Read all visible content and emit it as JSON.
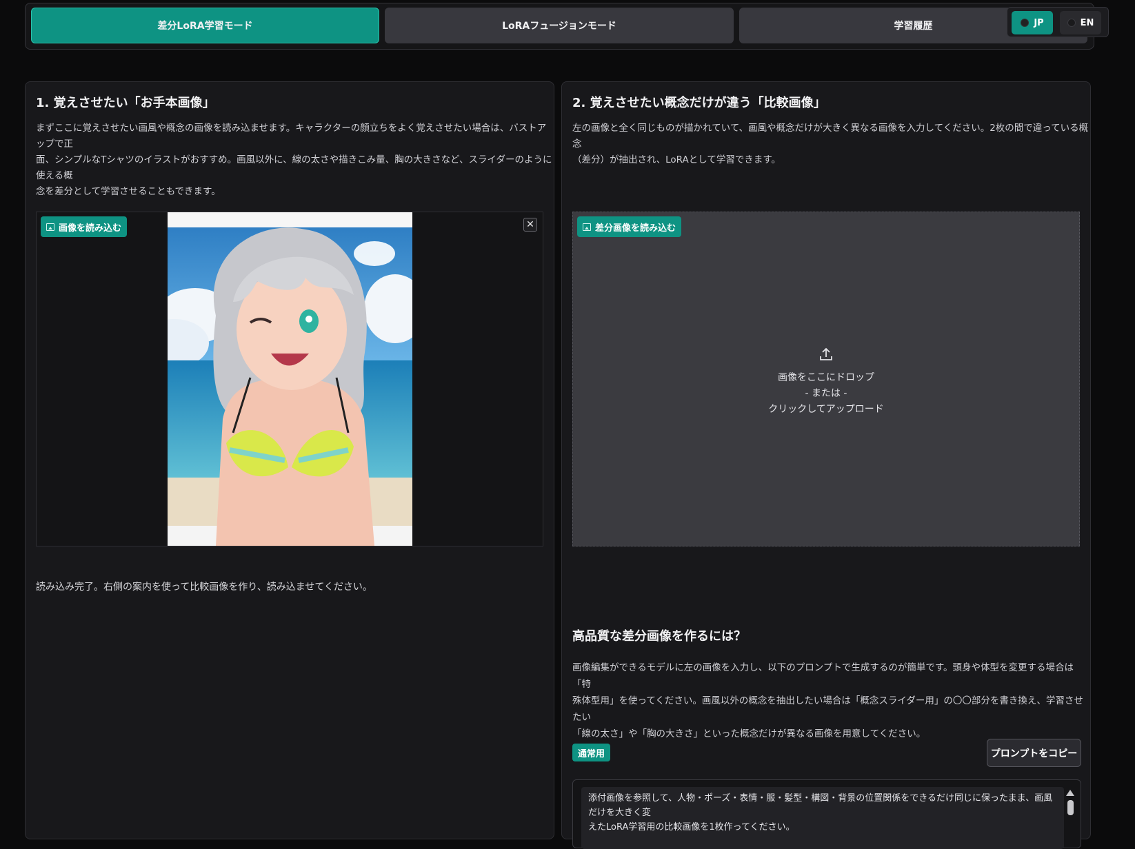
{
  "tabs": [
    {
      "label": "差分LoRA学習モード",
      "active": true
    },
    {
      "label": "LoRAフュージョンモード",
      "active": false
    },
    {
      "label": "学習履歴",
      "active": false
    }
  ],
  "language": {
    "jp": "JP",
    "en": "EN",
    "selected": "JP"
  },
  "left_panel": {
    "title": "1. 覚えさせたい「お手本画像」",
    "description_lines": [
      "まずここに覚えさせたい画風や概念の画像を読み込ませます。キャラクターの顔立ちをよく覚えさせたい場合は、バストアップで正",
      "面、シンプルなTシャツのイラストがおすすめ。画風以外に、線の太さや描きこみ量、胸の大きさなど、スライダーのように使える概",
      "念を差分として学習させることもできます。"
    ],
    "upload_label": "画像を読み込む",
    "close_symbol": "✕",
    "status": "読み込み完了。右側の案内を使って比較画像を作り、読み込ませてください。"
  },
  "right_panel": {
    "title": "2. 覚えさせたい概念だけが違う「比較画像」",
    "description_lines": [
      "左の画像と全く同じものが描かれていて、画風や概念だけが大きく異なる画像を入力してください。2枚の間で違っている概念",
      "（差分）が抽出され、LoRAとして学習できます。"
    ],
    "upload_label": "差分画像を読み込む",
    "dropzone": {
      "line1": "画像をここにドロップ",
      "line2": "- または -",
      "line3": "クリックしてアップロード"
    },
    "hq_title": "高品質な差分画像を作るには？",
    "hq_desc_lines": [
      "画像編集ができるモデルに左の画像を入力し、以下のプロンプトで生成するのが簡単です。頭身や体型を変更する場合は「特",
      "殊体型用」を使ってください。画風以外の概念を抽出したい場合は「概念スライダー用」の〇〇部分を書き換え、学習させたい",
      "「線の太さ」や「胸の大きさ」といった概念だけが異なる画像を用意してください。"
    ],
    "badge": "通常用",
    "copy_button": "プロンプトをコピー",
    "prompt_lines": [
      "添付画像を参照して、人物・ポーズ・表情・服・髪型・構図・背景の位置関係をできるだけ同じに保ったまま、画風だけを大きく変",
      "えたLoRA学習用の比較画像を1枚作ってください。"
    ]
  },
  "icons": {
    "upload": "upload-icon",
    "image": "image-icon",
    "close": "close-icon"
  },
  "colors": {
    "accent": "#0e9383",
    "background": "#0b0b0c",
    "panel": "#18181b"
  }
}
